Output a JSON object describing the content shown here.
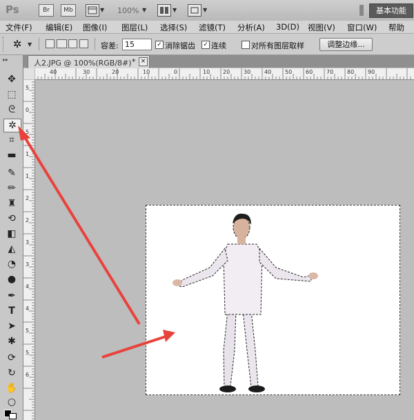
{
  "app": {
    "logo": "Ps"
  },
  "topbar": {
    "bridge_btn": "Br",
    "minibridge_btn": "Mb",
    "zoom_level": "100%",
    "workspace_label": "基本功能"
  },
  "menu": [
    "文件(F)",
    "编辑(E)",
    "图像(I)",
    "图层(L)",
    "选择(S)",
    "滤镜(T)",
    "分析(A)",
    "3D(D)",
    "视图(V)",
    "窗口(W)",
    "帮助"
  ],
  "options": {
    "tolerance_label": "容差:",
    "tolerance_value": "15",
    "anti_alias_label": "消除锯齿",
    "anti_alias_checked": true,
    "contiguous_label": "连续",
    "contiguous_checked": true,
    "sample_all_label": "对所有图层取样",
    "sample_all_checked": false,
    "refine_edge_label": "调整边缘..."
  },
  "document": {
    "tab_label": "人2.JPG @ 100%(RGB/8#)",
    "modified_marker": "*",
    "close_glyph": "×"
  },
  "rulers": {
    "horizontal": [
      "40",
      "30",
      "20",
      "10",
      "0",
      "10",
      "20",
      "30",
      "40",
      "50",
      "60",
      "70",
      "80",
      "90"
    ],
    "vertical": [
      "5",
      "0",
      "5",
      "1",
      "1",
      "2",
      "2",
      "3",
      "3",
      "4",
      "4",
      "5",
      "5",
      "6"
    ]
  },
  "tools": [
    {
      "name": "move-tool",
      "icon": "move-icon",
      "glyph": "✥"
    },
    {
      "name": "marquee-tool",
      "icon": "marquee-icon",
      "glyph": "⬚"
    },
    {
      "name": "lasso-tool",
      "icon": "lasso-icon",
      "glyph": "ᘓ"
    },
    {
      "name": "magic-wand-tool",
      "icon": "magic-wand-icon",
      "glyph": "✲",
      "active": true
    },
    {
      "name": "crop-tool",
      "icon": "crop-icon",
      "glyph": "⌗"
    },
    {
      "name": "ruler-tool",
      "icon": "ruler-icon",
      "glyph": "▬"
    },
    {
      "name": "healing-tool",
      "icon": "bandage-icon",
      "glyph": "✎"
    },
    {
      "name": "brush-tool",
      "icon": "brush-icon",
      "glyph": "✏"
    },
    {
      "name": "stamp-tool",
      "icon": "stamp-icon",
      "glyph": "♜"
    },
    {
      "name": "history-brush-tool",
      "icon": "history-brush-icon",
      "glyph": "⟲"
    },
    {
      "name": "eraser-tool",
      "icon": "eraser-icon",
      "glyph": "◧"
    },
    {
      "name": "bucket-tool",
      "icon": "paint-bucket-icon",
      "glyph": "◭"
    },
    {
      "name": "blur-tool",
      "icon": "blur-icon",
      "glyph": "◔"
    },
    {
      "name": "dodge-tool",
      "icon": "dodge-icon",
      "glyph": "●"
    },
    {
      "name": "pen-tool",
      "icon": "pen-icon",
      "glyph": "✒"
    },
    {
      "name": "type-tool",
      "icon": "type-icon",
      "glyph": "T"
    },
    {
      "name": "path-select-tool",
      "icon": "arrow-icon",
      "glyph": "➤"
    },
    {
      "name": "shape-tool",
      "icon": "shape-icon",
      "glyph": "✱"
    },
    {
      "name": "3d-rotate-tool",
      "icon": "3d-rotate-icon",
      "glyph": "⟳"
    },
    {
      "name": "3d-orbit-tool",
      "icon": "3d-orbit-icon",
      "glyph": "↻"
    },
    {
      "name": "hand-tool",
      "icon": "hand-icon",
      "glyph": "✋"
    },
    {
      "name": "zoom-tool",
      "icon": "zoom-icon",
      "glyph": "🔍︎"
    }
  ],
  "colors": {
    "annotation_arrow": "#e8423c",
    "selection_outline": "#222222"
  }
}
